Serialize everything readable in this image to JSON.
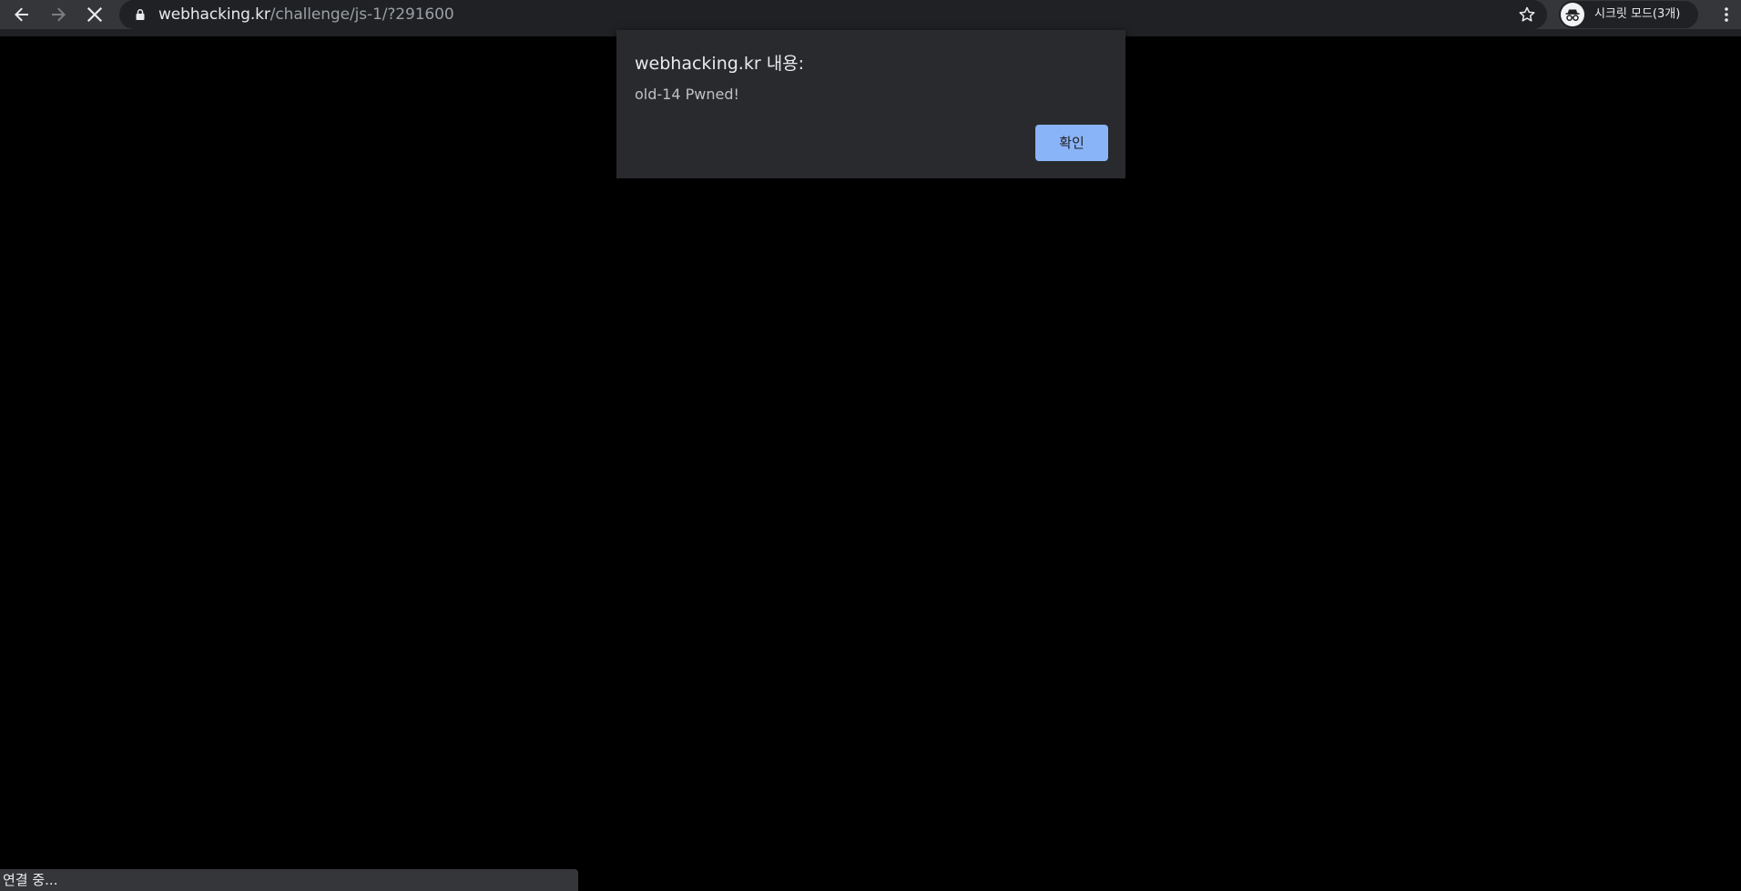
{
  "browser": {
    "url_host": "webhacking.kr",
    "url_path": "/challenge/js-1/?291600",
    "incognito_label": "시크릿 모드(3개)",
    "icons": {
      "back": "arrow-left-icon",
      "forward": "arrow-right-icon",
      "stop": "close-icon",
      "lock": "lock-icon",
      "bookmark": "star-icon",
      "incognito": "incognito-icon",
      "menu": "kebab-menu-icon"
    }
  },
  "alert": {
    "title": "webhacking.kr 내용:",
    "message": "old-14 Pwned!",
    "ok_label": "확인"
  },
  "status": {
    "text": "연결 중..."
  },
  "colors": {
    "toolbar": "#35363a",
    "omnibox": "#202124",
    "page_background": "#000000",
    "dialog": "#292a2d",
    "accent_button": "#8ab4f8"
  }
}
